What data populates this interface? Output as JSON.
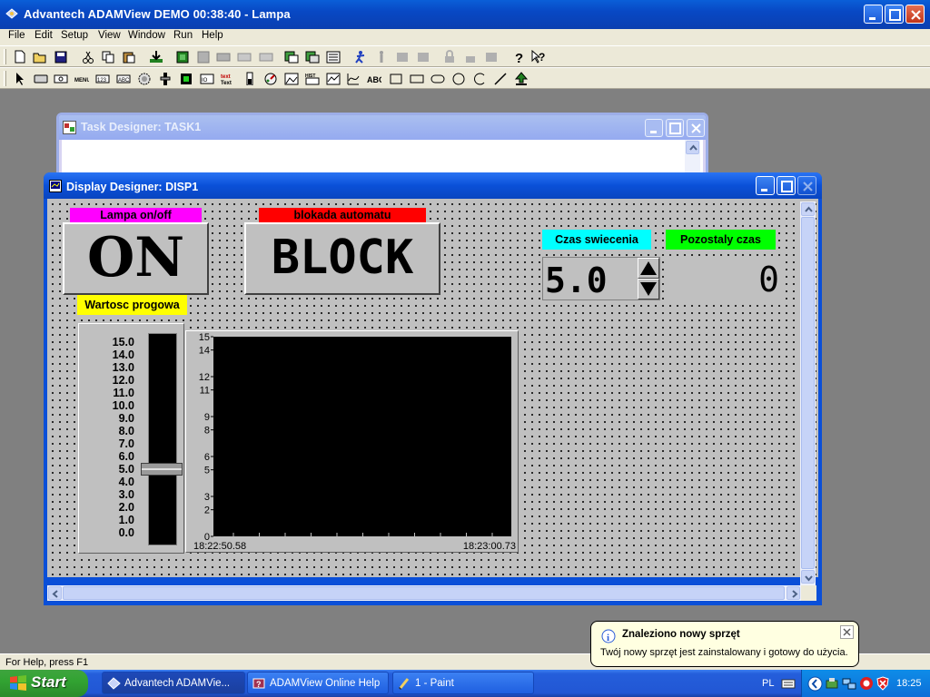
{
  "window": {
    "title": "Advantech ADAMView DEMO 00:38:40 - Lampa"
  },
  "menu": [
    "File",
    "Edit",
    "Setup",
    "View",
    "Window",
    "Run",
    "Help"
  ],
  "task_designer": {
    "title": "Task Designer:  TASK1"
  },
  "display_designer": {
    "title": "Display Designer: DISP1",
    "lamp_label": "Lampa on/off",
    "lamp_button": "ON",
    "block_label": "blokada automatu",
    "block_button": "BLOCK",
    "time_label": "Czas swiecenia",
    "time_value": "5.0",
    "remaining_label": "Pozostaly czas",
    "remaining_value": "0",
    "threshold_label": "Wartosc progowa",
    "slider": {
      "ticks": [
        "15.0",
        "14.0",
        "13.0",
        "12.0",
        "11.0",
        "10.0",
        "9.0",
        "8.0",
        "7.0",
        "6.0",
        "5.0",
        "4.0",
        "3.0",
        "2.0",
        "1.0",
        "0.0"
      ],
      "value": 5.0
    },
    "trend": {
      "y_ticks": [
        "15",
        "14",
        "12",
        "11",
        "9",
        "8",
        "6",
        "5",
        "3",
        "2",
        "0"
      ],
      "x_start": "18:22:50.58",
      "x_end": "18:23:00.73"
    }
  },
  "status": {
    "text": "For Help, press F1"
  },
  "taskbar": {
    "start": "Start",
    "buttons": [
      "Advantech ADAMVie...",
      "ADAMView Online Help",
      "1 - Paint"
    ],
    "lang": "PL",
    "clock": "18:25"
  },
  "balloon": {
    "title": "Znaleziono nowy sprzęt",
    "text": "Twój nowy sprzęt jest zainstalowany i gotowy do użycia."
  },
  "colors": {
    "lamp_label_bg": "#ff00ff",
    "block_label_bg": "#ff0000",
    "time_label_bg": "#00ffff",
    "remaining_label_bg": "#00ff00",
    "threshold_label_bg": "#ffff00"
  }
}
